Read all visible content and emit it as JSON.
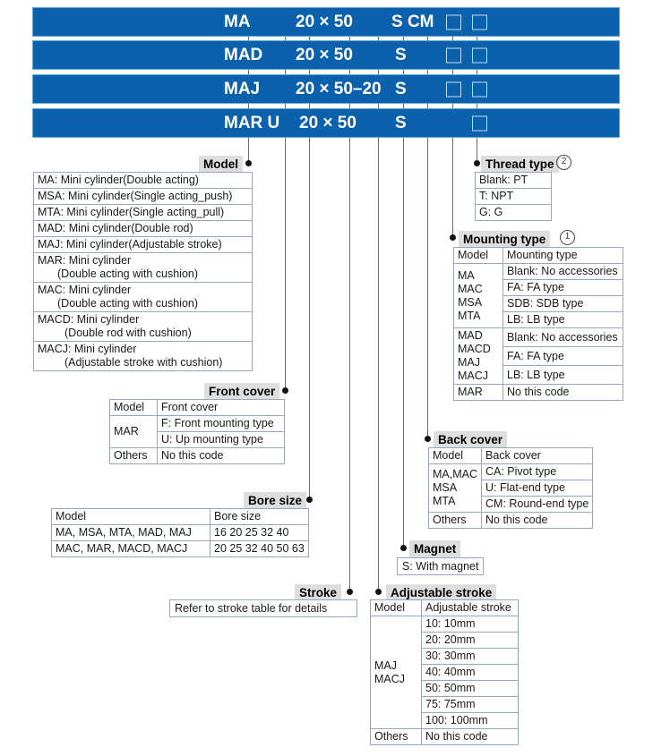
{
  "meta": {
    "title": "Mini cylinder model designation code diagram",
    "bar_color": "#0B61AC"
  },
  "code_bars": [
    {
      "id": "bar-ma",
      "model": "MA",
      "size": "20 × 50",
      "suffix": "S CM",
      "boxes": 2
    },
    {
      "id": "bar-mad",
      "model": "MAD",
      "size": "20 × 50",
      "suffix": "S",
      "boxes": 2
    },
    {
      "id": "bar-maj",
      "model": "MAJ",
      "size": "20 × 50–20",
      "suffix": "S",
      "boxes": 2
    },
    {
      "id": "bar-mar",
      "model": "MAR U",
      "size": "20 × 50",
      "suffix": "S",
      "boxes": 1
    }
  ],
  "sections": {
    "model": {
      "title": "Model",
      "rows": [
        {
          "code": "MA:",
          "desc": "Mini cylinder(Double acting)",
          "line2": ""
        },
        {
          "code": "MSA:",
          "desc": "Mini cylinder(Single acting_push)",
          "line2": ""
        },
        {
          "code": "MTA:",
          "desc": "Mini cylinder(Single acting_pull)",
          "line2": ""
        },
        {
          "code": "MAD:",
          "desc": "Mini cylinder(Double rod)",
          "line2": ""
        },
        {
          "code": "MAJ:",
          "desc": "Mini cylinder(Adjustable stroke)",
          "line2": ""
        },
        {
          "code": "MAR:",
          "desc": "Mini cylinder",
          "line2": "(Double acting with cushion)"
        },
        {
          "code": "MAC:",
          "desc": "Mini cylinder",
          "line2": "(Double acting with cushion)"
        },
        {
          "code": "MACD:",
          "desc": "Mini cylinder",
          "line2": "(Double rod with cushion)"
        },
        {
          "code": "MACJ:",
          "desc": "Mini cylinder",
          "line2": "(Adjustable stroke with cushion)"
        }
      ]
    },
    "thread_type": {
      "title": "Thread type",
      "badge": "2",
      "rows": [
        "Blank: PT",
        "T: NPT",
        "G: G"
      ]
    },
    "mounting_type": {
      "title": "Mounting type",
      "badge": "1",
      "header": [
        "Model",
        "Mounting type"
      ],
      "groups": [
        {
          "models": "MA\nMAC\nMSA\nMTA",
          "options": [
            "Blank: No accessories",
            "FA: FA type",
            "SDB: SDB type",
            "LB: LB type"
          ]
        },
        {
          "models": "MAD\nMACD\nMAJ\nMACJ",
          "options": [
            "Blank: No accessories",
            "FA: FA type",
            "LB: LB type"
          ]
        },
        {
          "models": "MAR",
          "options": [
            "No this code"
          ]
        }
      ]
    },
    "front_cover": {
      "title": "Front cover",
      "header": [
        "Model",
        "Front cover"
      ],
      "groups": [
        {
          "models": "MAR",
          "options": [
            "F: Front mounting type",
            "U: Up mounting type"
          ]
        },
        {
          "models": "Others",
          "options": [
            "No this code"
          ]
        }
      ]
    },
    "back_cover": {
      "title": "Back cover",
      "header": [
        "Model",
        "Back cover"
      ],
      "groups": [
        {
          "models": "MA,MAC\nMSA\nMTA",
          "options": [
            "CA: Pivot type",
            "U: Flat-end type",
            "CM: Round-end type"
          ]
        },
        {
          "models": "Others",
          "options": [
            "No this code"
          ]
        }
      ]
    },
    "bore_size": {
      "title": "Bore size",
      "header": [
        "Model",
        "Bore size"
      ],
      "rows": [
        {
          "models": "MA, MSA, MTA, MAD, MAJ",
          "sizes": "16 20 25 32 40"
        },
        {
          "models": "MAC, MAR, MACD, MACJ",
          "sizes": "20 25 32 40 50 63"
        }
      ]
    },
    "magnet": {
      "title": "Magnet",
      "value": "S: With magnet"
    },
    "stroke": {
      "title": "Stroke",
      "value": "Refer to stroke table for details"
    },
    "adjustable_stroke": {
      "title": "Adjustable stroke",
      "header": [
        "Model",
        "Adjustable stroke"
      ],
      "groups": [
        {
          "models": "MAJ\nMACJ",
          "options": [
            "10: 10mm",
            "20: 20mm",
            "30: 30mm",
            "40: 40mm",
            "50: 50mm",
            "75: 75mm",
            "100: 100mm"
          ]
        },
        {
          "models": "Others",
          "options": [
            "No this code"
          ]
        }
      ]
    }
  }
}
